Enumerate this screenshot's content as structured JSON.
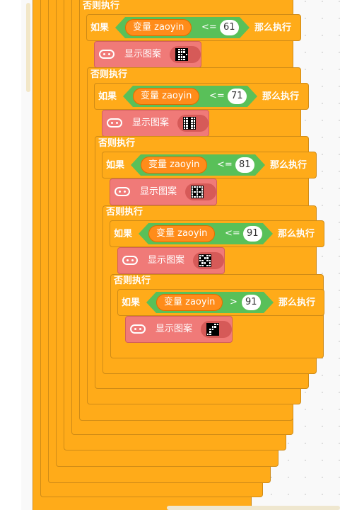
{
  "labels": {
    "else": "否则执行",
    "if": "如果",
    "then": "那么执行",
    "show_pattern": "显示图案"
  },
  "blocks": [
    {
      "variable": "变量 zaoyin",
      "operator": "<=",
      "value": "61",
      "pattern": [
        0,
        1,
        1,
        1,
        0,
        0,
        1,
        1,
        1,
        0,
        0,
        1,
        1,
        0,
        1,
        0,
        1,
        1,
        1,
        0,
        0,
        1,
        1,
        1,
        0
      ]
    },
    {
      "variable": "变量 zaoyin",
      "operator": "<=",
      "value": "71",
      "pattern": [
        1,
        1,
        0,
        1,
        1,
        1,
        1,
        0,
        1,
        1,
        1,
        1,
        0,
        1,
        1,
        1,
        1,
        0,
        1,
        1,
        1,
        1,
        0,
        1,
        1
      ]
    },
    {
      "variable": "变量 zaoyin",
      "operator": "<=",
      "value": "81",
      "pattern": [
        1,
        1,
        1,
        1,
        1,
        1,
        0,
        1,
        0,
        1,
        1,
        1,
        1,
        1,
        1,
        1,
        0,
        1,
        0,
        1,
        1,
        1,
        1,
        1,
        1
      ]
    },
    {
      "variable": "变量 zaoyin",
      "operator": "<=",
      "value": "91",
      "pattern": [
        1,
        1,
        0,
        1,
        1,
        1,
        0,
        1,
        1,
        0,
        1,
        1,
        0,
        1,
        1,
        0,
        1,
        1,
        0,
        1,
        1,
        1,
        0,
        1,
        1
      ]
    },
    {
      "variable": "变量 zaoyin",
      "operator": ">",
      "value": "91",
      "pattern": [
        0,
        0,
        0,
        1,
        1,
        0,
        0,
        1,
        1,
        0,
        0,
        1,
        1,
        0,
        0,
        0,
        1,
        0,
        0,
        0,
        1,
        1,
        0,
        0,
        0
      ]
    }
  ]
}
